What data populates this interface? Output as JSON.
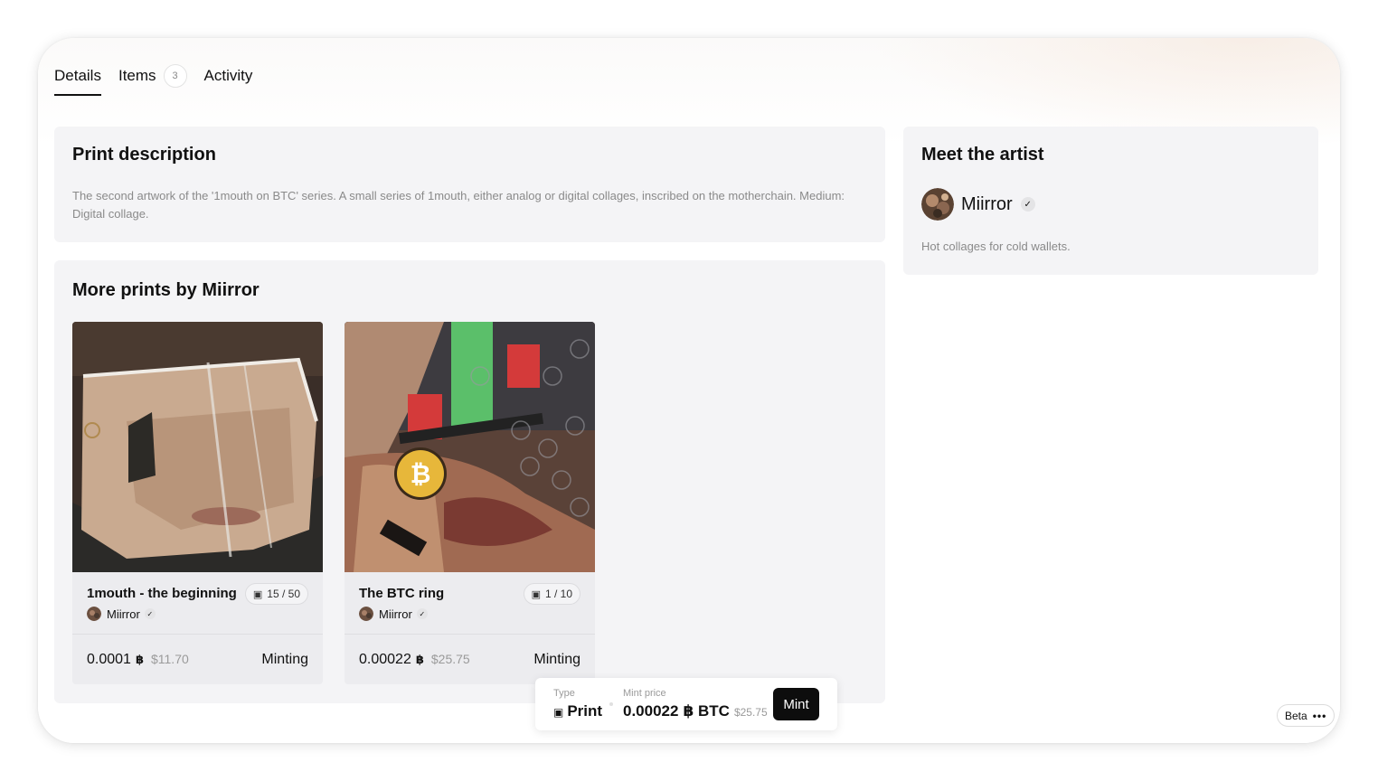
{
  "tabs": [
    {
      "label": "Details",
      "active": true
    },
    {
      "label": "Items",
      "count": "3"
    },
    {
      "label": "Activity"
    }
  ],
  "description": {
    "title": "Print description",
    "text": "The second artwork of the '1mouth on BTC' series. A small series of 1mouth, either analog or digital collages, inscribed on the motherchain. Medium: Digital collage."
  },
  "more_prints": {
    "title": "More prints by Miirror",
    "items": [
      {
        "name": "1mouth - the beginning",
        "edition": "15 / 50",
        "artist": "Miirror",
        "price": "0.0001",
        "price_unit": "฿",
        "usd": "$11.70",
        "status": "Minting"
      },
      {
        "name": "The BTC ring",
        "edition": "1 / 10",
        "artist": "Miirror",
        "price": "0.00022",
        "price_unit": "฿",
        "usd": "$25.75",
        "status": "Minting"
      }
    ]
  },
  "artist": {
    "title": "Meet the artist",
    "name": "Miirror",
    "bio": "Hot collages for cold wallets."
  },
  "mint_bar": {
    "type_label": "Type",
    "type_value": "Print",
    "price_label": "Mint price",
    "price_value": "0.00022",
    "price_unit": "฿ BTC",
    "usd": "$25.75",
    "button": "Mint"
  },
  "beta": {
    "label": "Beta"
  },
  "icons": {
    "verified": "check-badge-icon",
    "edition": "prints-stack-icon",
    "more": "more-dots-icon"
  }
}
